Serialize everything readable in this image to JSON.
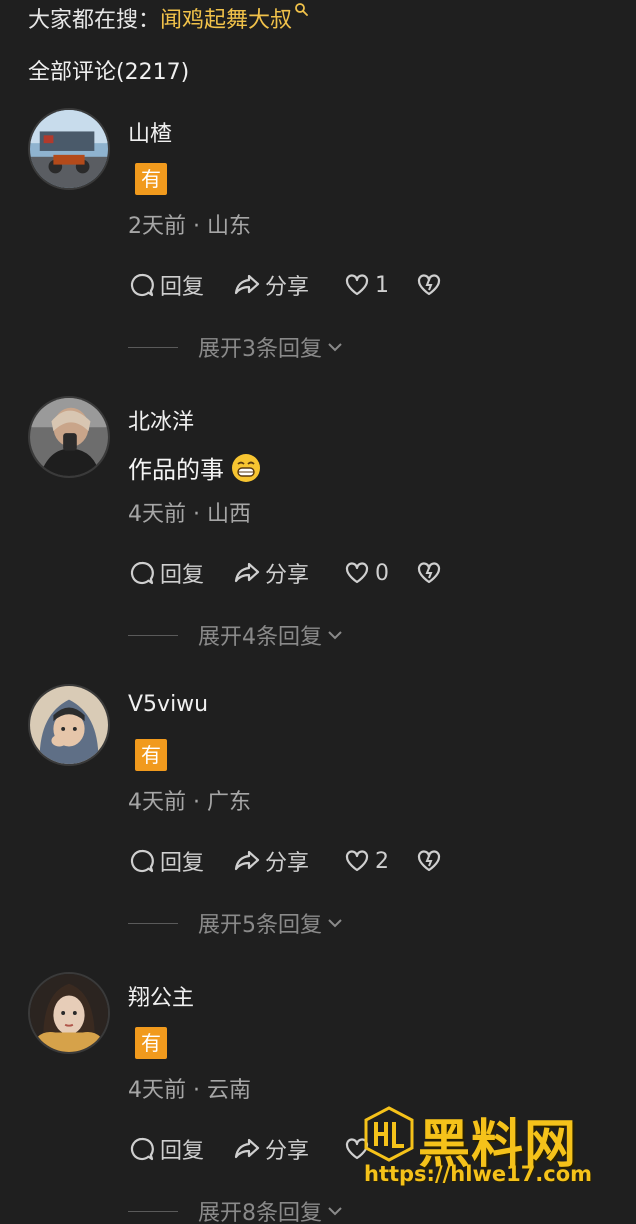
{
  "search": {
    "prefix": "大家都在搜：",
    "query": "闻鸡起舞大叔"
  },
  "comments_header": "全部评论(2217)",
  "actions": {
    "reply": "回复",
    "share": "分享"
  },
  "comments": [
    {
      "username": "山楂",
      "badge": "有",
      "meta": "2天前 · 山东",
      "likes": "1",
      "expand": "展开3条回复"
    },
    {
      "username": "北冰洋",
      "text": "作品的事",
      "meta": "4天前 · 山西",
      "likes": "0",
      "expand": "展开4条回复"
    },
    {
      "username": "V5viwu",
      "badge": "有",
      "meta": "4天前 · 广东",
      "likes": "2",
      "expand": "展开5条回复"
    },
    {
      "username": "翔公主",
      "badge": "有",
      "meta": "4天前 · 云南",
      "likes": "",
      "expand": "展开8条回复"
    }
  ],
  "watermark": {
    "title": "黑料网",
    "url": "https://hlwe17.com"
  },
  "colors": {
    "background": "#1f1f1f",
    "accent": "#f1c24a",
    "badge": "#f19a1d"
  }
}
